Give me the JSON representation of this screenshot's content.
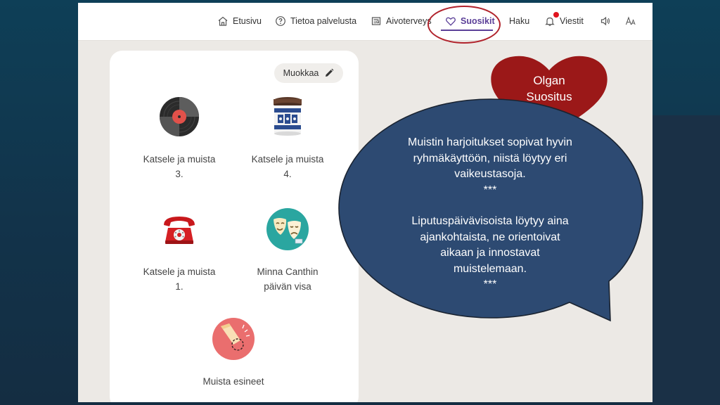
{
  "nav": {
    "home": "Etusivu",
    "about": "Tietoa palvelusta",
    "brain_health": "Aivoterveys",
    "favorites": "Suosikit",
    "search": "Haku",
    "messages": "Viestit"
  },
  "card": {
    "edit_label": "Muokkaa",
    "tiles": [
      {
        "line1": "Katsele ja muista",
        "line2": "3.",
        "icon": "vinyl-record-icon"
      },
      {
        "line1": "Katsele ja muista",
        "line2": "4.",
        "icon": "jar-icon"
      },
      {
        "line1": "Katsele ja muista",
        "line2": "1.",
        "icon": "telephone-icon"
      },
      {
        "line1": "Minna Canthin",
        "line2": "päivän visa",
        "icon": "theater-masks-icon"
      },
      {
        "line1": "Muista esineet",
        "line2": "",
        "icon": "flashlight-icon"
      }
    ]
  },
  "heart": {
    "line1": "Olgan",
    "line2": "Suositus"
  },
  "bubble": {
    "para1": [
      "Muistin harjoitukset sopivat hyvin",
      "ryhmäkäyttöön, niistä löytyy eri",
      "vaikeustasoja.",
      "***"
    ],
    "para2": [
      "Liputuspäivävisoista löytyy aina",
      "ajankohtaista, ne orientoivat",
      "aikaan ja innostavat",
      "muistelemaan.",
      "***"
    ]
  },
  "colors": {
    "accent": "#5b3f98",
    "heart": "#9b1818",
    "bubble": "#2d4a72",
    "highlight": "#b1232c"
  }
}
